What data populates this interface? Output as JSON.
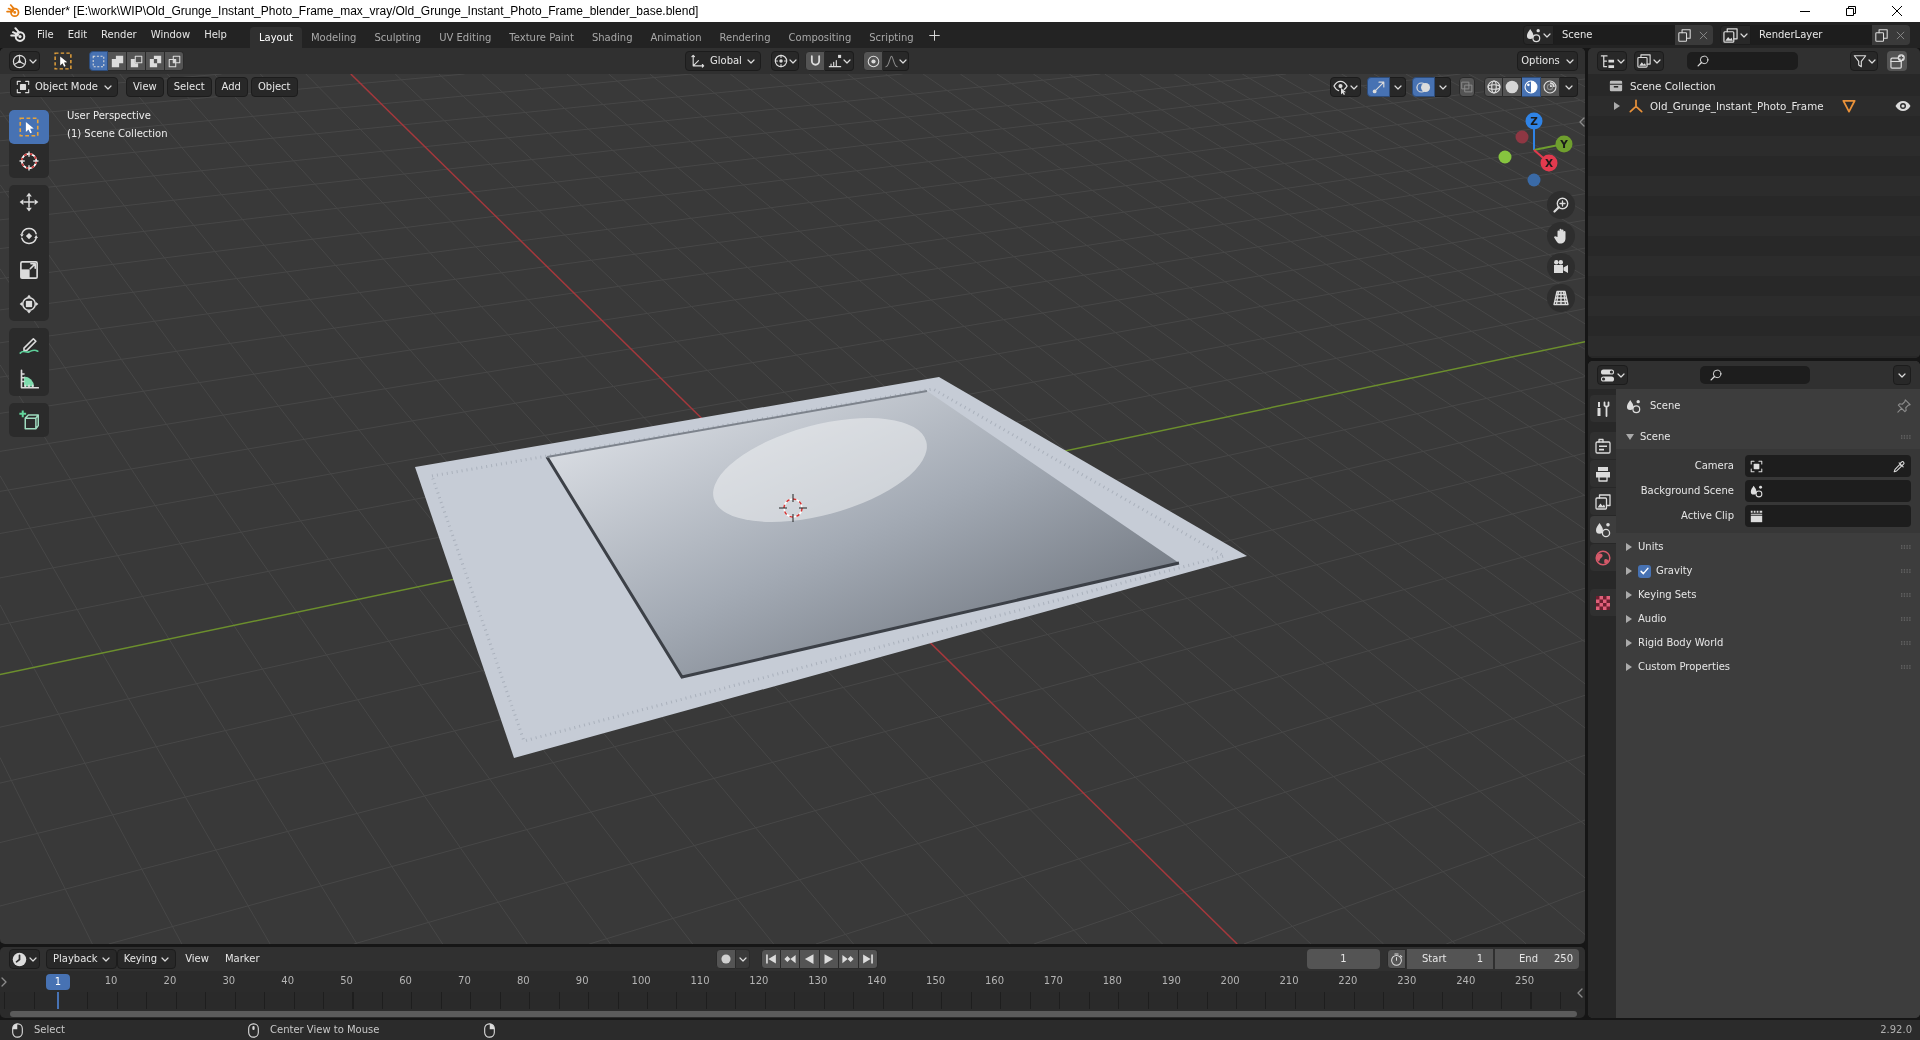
{
  "window": {
    "title": "Blender* [E:\\work\\WIP\\Old_Grunge_Instant_Photo_Frame_max_vray/Old_Grunge_Instant_Photo_Frame_blender_base.blend]"
  },
  "menu": [
    "File",
    "Edit",
    "Render",
    "Window",
    "Help"
  ],
  "workspaces": [
    {
      "label": "Layout",
      "selected": true
    },
    {
      "label": "Modeling",
      "selected": false
    },
    {
      "label": "Sculpting",
      "selected": false
    },
    {
      "label": "UV Editing",
      "selected": false
    },
    {
      "label": "Texture Paint",
      "selected": false
    },
    {
      "label": "Shading",
      "selected": false
    },
    {
      "label": "Animation",
      "selected": false
    },
    {
      "label": "Rendering",
      "selected": false
    },
    {
      "label": "Compositing",
      "selected": false
    },
    {
      "label": "Scripting",
      "selected": false
    }
  ],
  "scene": {
    "value": "Scene"
  },
  "view_layer": {
    "value": "RenderLayer"
  },
  "viewport": {
    "select_modes": [
      {
        "kind": "set",
        "selected": true
      },
      {
        "kind": "extend",
        "selected": false
      },
      {
        "kind": "subtract",
        "selected": false
      },
      {
        "kind": "invert",
        "selected": false
      },
      {
        "kind": "intersect",
        "selected": false
      }
    ],
    "orientation": "Global",
    "snap": {
      "on": false
    },
    "proportional": {
      "on": false
    },
    "options": "Options",
    "mode": "Object Mode",
    "menus": [
      "View",
      "Select",
      "Add",
      "Object"
    ],
    "gizmos": {
      "on": true
    },
    "overlays": {
      "on": true
    },
    "xray": {
      "on": false
    },
    "shading": [
      {
        "kind": "wireframe",
        "selected": false
      },
      {
        "kind": "solid",
        "selected": false
      },
      {
        "kind": "material",
        "selected": true
      },
      {
        "kind": "rendered",
        "selected": false
      }
    ],
    "info": [
      "User Perspective",
      "(1) Scene Collection"
    ],
    "tools": [
      {
        "kind": "select",
        "selected": true
      },
      {
        "kind": "cursor",
        "selected": false
      },
      {
        "kind": "move",
        "selected": false
      },
      {
        "kind": "rotate",
        "selected": false
      },
      {
        "kind": "scale",
        "selected": false
      },
      {
        "kind": "transform",
        "selected": false
      },
      {
        "kind": "annotate",
        "selected": false
      },
      {
        "kind": "measure",
        "selected": false
      },
      {
        "kind": "cube",
        "selected": false
      }
    ],
    "axes": [
      {
        "kind": "positive",
        "label": "Z",
        "color": "#2f83e6"
      },
      {
        "kind": "positive",
        "label": "Y",
        "color": "#6f9f2e"
      },
      {
        "kind": "positive",
        "label": "X",
        "color": "#e23a4e"
      },
      {
        "kind": "negative",
        "color": "#8e3743"
      },
      {
        "kind": "negative",
        "color": "#86c43f"
      },
      {
        "kind": "negative",
        "color": "#3a6aa6"
      }
    ]
  },
  "outliner": {
    "items": [
      {
        "label": "Scene Collection",
        "kind": "collection",
        "children": [
          {
            "label": "Old_Grunge_Instant_Photo_Frame",
            "kind": "object",
            "expanded": false,
            "visible": true
          }
        ]
      }
    ]
  },
  "properties": {
    "tabs": [
      {
        "kind": "tool",
        "selected": false
      },
      {
        "kind": "render",
        "selected": false
      },
      {
        "kind": "output",
        "selected": false
      },
      {
        "kind": "viewlayer",
        "selected": false
      },
      {
        "kind": "scene",
        "selected": true
      },
      {
        "kind": "world",
        "selected": false
      },
      {
        "kind": "texture",
        "selected": false
      }
    ],
    "context": "Scene",
    "panels": [
      {
        "title": "Scene",
        "kind": "plain",
        "expanded": true,
        "fields": [
          {
            "label": "Camera",
            "kind": "camera"
          },
          {
            "label": "Background Scene",
            "kind": "scene"
          },
          {
            "label": "Active Clip",
            "kind": "clip"
          }
        ]
      },
      {
        "title": "Units",
        "kind": "plain",
        "expanded": false
      },
      {
        "title": "Gravity",
        "kind": "toggle",
        "expanded": false,
        "checked": true
      },
      {
        "title": "Keying Sets",
        "kind": "plain",
        "expanded": false
      },
      {
        "title": "Audio",
        "kind": "plain",
        "expanded": false
      },
      {
        "title": "Rigid Body World",
        "kind": "plain",
        "expanded": false
      },
      {
        "title": "Custom Properties",
        "kind": "plain",
        "expanded": false
      }
    ]
  },
  "timeline": {
    "menus": [
      {
        "label": "Playback",
        "kind": "dropdown"
      },
      {
        "label": "Keying",
        "kind": "dropdown"
      },
      {
        "label": "View",
        "kind": "menu"
      },
      {
        "label": "Marker",
        "kind": "menu"
      }
    ],
    "auto_keying": {
      "on": false
    },
    "current_frame": "1",
    "start": {
      "label": "Start",
      "value": "1"
    },
    "end": {
      "label": "End",
      "value": "250"
    },
    "playhead": "1",
    "ruler": [
      "10",
      "20",
      "30",
      "40",
      "50",
      "60",
      "70",
      "80",
      "90",
      "100",
      "110",
      "120",
      "130",
      "140",
      "150",
      "160",
      "170",
      "180",
      "190",
      "200",
      "210",
      "220",
      "230",
      "240",
      "250"
    ]
  },
  "status_bar": {
    "hints": [
      {
        "kind": "left",
        "label": "Select"
      },
      {
        "kind": "middle",
        "label": "Center View to Mouse"
      },
      {
        "kind": "right"
      }
    ],
    "version": "2.92.0"
  }
}
